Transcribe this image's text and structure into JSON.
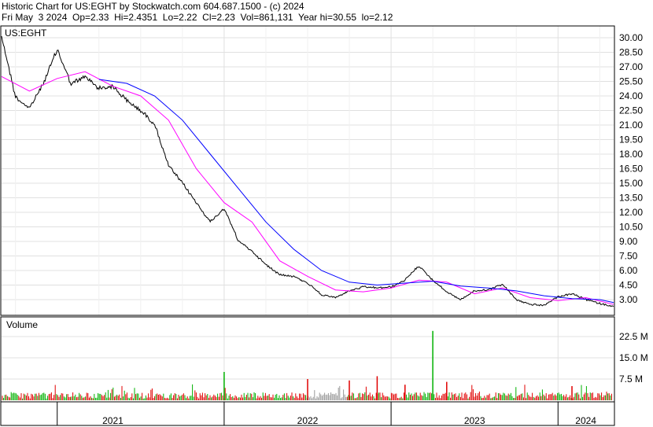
{
  "header": {
    "line1": "Historic Chart for US:EGHT by Stockwatch.com 604.687.1500 - (c) 2024",
    "line2": "Fri May  3 2024  Op=2.33  Hi=2.4351  Lo=2.22  Cl=2.23  Vol=861,131  Year hi=30.55  lo=2.12"
  },
  "chart_data": [
    {
      "type": "line",
      "title": "US:EGHT",
      "x_range": [
        "2020-09",
        "2024-05"
      ],
      "y_ticks": [
        "30.00",
        "28.50",
        "27.00",
        "25.50",
        "24.00",
        "22.50",
        "21.00",
        "19.50",
        "18.00",
        "16.50",
        "15.00",
        "13.50",
        "12.00",
        "10.50",
        "9.00",
        "7.50",
        "6.00",
        "4.50",
        "3.00"
      ],
      "ylim": [
        1.5,
        30.5
      ],
      "year_labels": [
        "2021",
        "2022",
        "2023",
        "2024"
      ],
      "grid": true,
      "series": [
        {
          "color": "#000000",
          "x": [
            "2020-09",
            "2020-10",
            "2020-11",
            "2020-12",
            "2021-01",
            "2021-02",
            "2021-03",
            "2021-04",
            "2021-05",
            "2021-06",
            "2021-07",
            "2021-08",
            "2021-09",
            "2021-10",
            "2021-11",
            "2021-12",
            "2022-01",
            "2022-02",
            "2022-03",
            "2022-04",
            "2022-05",
            "2022-06",
            "2022-07",
            "2022-08",
            "2022-09",
            "2022-10",
            "2022-11",
            "2022-12",
            "2023-01",
            "2023-02",
            "2023-03",
            "2023-04",
            "2023-05",
            "2023-06",
            "2023-07",
            "2023-08",
            "2023-09",
            "2023-10",
            "2023-11",
            "2023-12",
            "2024-01",
            "2024-02",
            "2024-03",
            "2024-04",
            "2024-05"
          ],
          "values": [
            30.2,
            23.9,
            22.7,
            25.3,
            28.8,
            25.2,
            26.0,
            24.8,
            25.0,
            23.5,
            22.5,
            21.1,
            16.8,
            15.0,
            13.0,
            11.0,
            12.4,
            9.1,
            8.0,
            6.6,
            5.6,
            5.4,
            4.7,
            3.5,
            3.2,
            3.9,
            4.3,
            4.2,
            4.3,
            5.0,
            6.5,
            5.0,
            3.8,
            3.0,
            3.9,
            4.0,
            4.6,
            3.0,
            2.5,
            2.4,
            3.3,
            3.6,
            3.0,
            2.6,
            2.3
          ]
        },
        {
          "color": "#ff00ff",
          "x": [
            "2020-09",
            "2020-11",
            "2021-01",
            "2021-03",
            "2021-05",
            "2021-07",
            "2021-09",
            "2021-11",
            "2022-01",
            "2022-03",
            "2022-05",
            "2022-07",
            "2022-09",
            "2022-11",
            "2023-01",
            "2023-03",
            "2023-05",
            "2023-07",
            "2023-09",
            "2023-11",
            "2024-01",
            "2024-03",
            "2024-05"
          ],
          "values": [
            26.0,
            24.5,
            25.8,
            26.5,
            25.0,
            24.0,
            21.5,
            16.5,
            13.0,
            11.0,
            7.0,
            5.4,
            4.0,
            3.8,
            4.2,
            5.0,
            4.8,
            3.6,
            4.2,
            3.2,
            2.9,
            3.2,
            2.5
          ]
        },
        {
          "color": "#0000ff",
          "x": [
            "2021-04",
            "2021-06",
            "2021-08",
            "2021-10",
            "2021-12",
            "2022-02",
            "2022-04",
            "2022-06",
            "2022-08",
            "2022-10",
            "2022-12",
            "2023-02",
            "2023-04",
            "2023-06",
            "2023-08",
            "2023-10",
            "2023-12",
            "2024-02",
            "2024-04",
            "2024-05"
          ],
          "values": [
            25.7,
            25.3,
            24.0,
            21.5,
            18.0,
            14.5,
            11.0,
            8.2,
            6.0,
            4.8,
            4.5,
            4.7,
            4.9,
            4.4,
            4.2,
            3.9,
            3.4,
            3.1,
            3.0,
            2.7
          ]
        }
      ]
    },
    {
      "type": "bar",
      "title": "Volume",
      "y_ticks": [
        "22.5 M",
        "15.0 M",
        "7.5 M"
      ],
      "ylim": [
        0,
        30
      ],
      "x_range": [
        "2020-09",
        "2024-05"
      ],
      "spikes": [
        {
          "x": "2023-04",
          "value": 24.5
        },
        {
          "x": "2022-01",
          "value": 10.0
        },
        {
          "x": "2022-07",
          "value": 7.5
        },
        {
          "x": "2022-10",
          "value": 7.0
        },
        {
          "x": "2022-12",
          "value": 8.5
        },
        {
          "x": "2023-05",
          "value": 6.5
        },
        {
          "x": "2023-02",
          "value": 5.5
        },
        {
          "x": "2024-02",
          "value": 5.0
        }
      ]
    }
  ]
}
